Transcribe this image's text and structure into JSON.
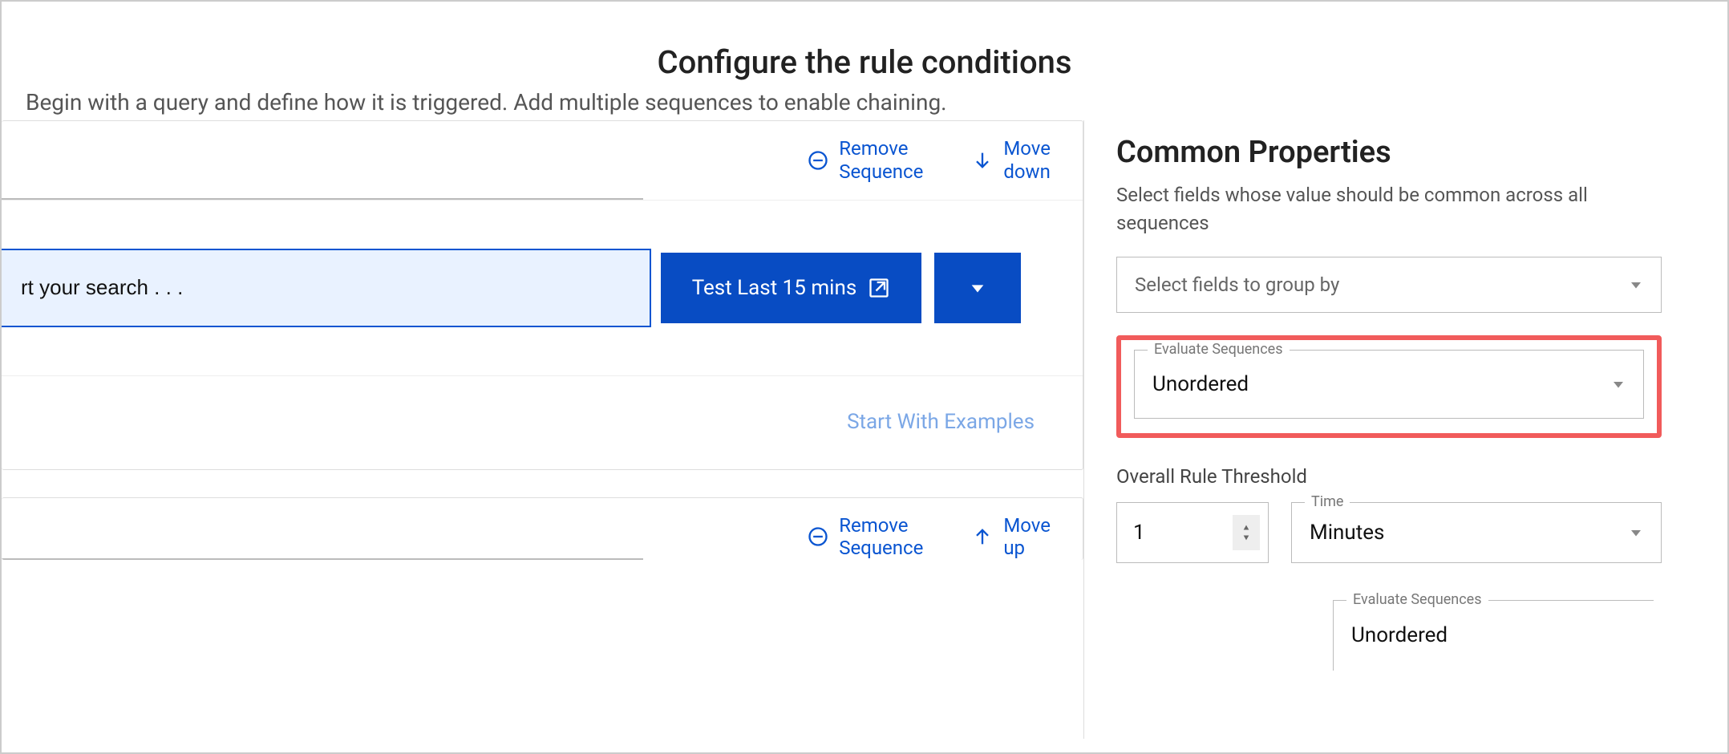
{
  "header": {
    "title": "Configure the rule conditions",
    "subtitle": "Begin with a query and define how it is triggered. Add multiple sequences to enable chaining."
  },
  "sequence1": {
    "remove_label": "Remove\nSequence",
    "move_label": "Move\ndown",
    "search_value": "rt your search . . .",
    "test_label": "Test Last 15 mins",
    "examples_label": "Start With Examples"
  },
  "sequence2": {
    "remove_label": "Remove\nSequence",
    "move_label": "Move\nup"
  },
  "right": {
    "heading": "Common Properties",
    "desc": "Select fields whose value should be common across all sequences",
    "group_placeholder": "Select fields to group by",
    "eval_label": "Evaluate Sequences",
    "eval_value": "Unordered",
    "threshold_label": "Overall Rule Threshold",
    "threshold_value": "1",
    "time_label": "Time",
    "time_unit": "Minutes",
    "callout_label": "Evaluate Sequences",
    "callout_value": "Unordered"
  }
}
